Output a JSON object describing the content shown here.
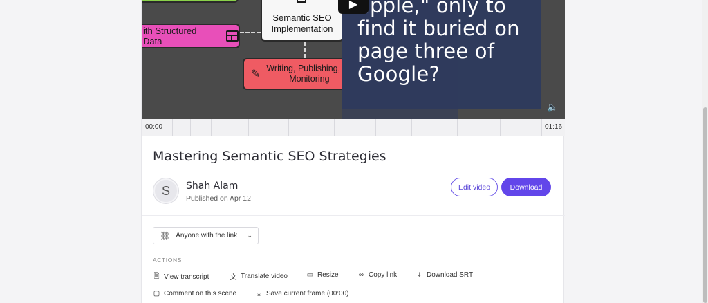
{
  "video": {
    "nodes": {
      "structured_data": "ith Structured Data",
      "semantic_line1": "Semantic SEO",
      "semantic_line2": "Implementation",
      "writing_line1": "Writing, Publishing, an",
      "writing_line2": "Monitoring"
    },
    "caption": "apple,\" only to find it buried on page three of Google?",
    "time_start": "00:00",
    "time_end": "01:16",
    "icons": {
      "play": "play-icon",
      "volume": "volume-icon",
      "table": "table-icon",
      "pen": "pen-icon",
      "magnifier": "magnifier-icon"
    }
  },
  "details": {
    "title": "Mastering Semantic SEO Strategies",
    "avatar_initial": "S",
    "author": "Shah Alam",
    "published": "Published on Apr 12",
    "edit_label": "Edit video",
    "download_label": "Download"
  },
  "share": {
    "selected": "Anyone with the link"
  },
  "actions": {
    "label": "ACTIONS",
    "items": [
      {
        "label": "View transcript",
        "icon": "document-icon"
      },
      {
        "label": "Translate video",
        "icon": "translate-icon"
      },
      {
        "label": "Resize",
        "icon": "resize-icon"
      },
      {
        "label": "Copy link",
        "icon": "link-icon"
      },
      {
        "label": "Download SRT",
        "icon": "download-icon"
      },
      {
        "label": "Comment on this scene",
        "icon": "comment-icon"
      },
      {
        "label": "Save current frame (00:00)",
        "icon": "download-icon"
      }
    ]
  },
  "colors": {
    "accent": "#6246ea",
    "overlay": "#2f3b5c",
    "node_pink": "#e84fb9",
    "node_red": "#ef5b63",
    "node_green": "#8ad14a"
  }
}
